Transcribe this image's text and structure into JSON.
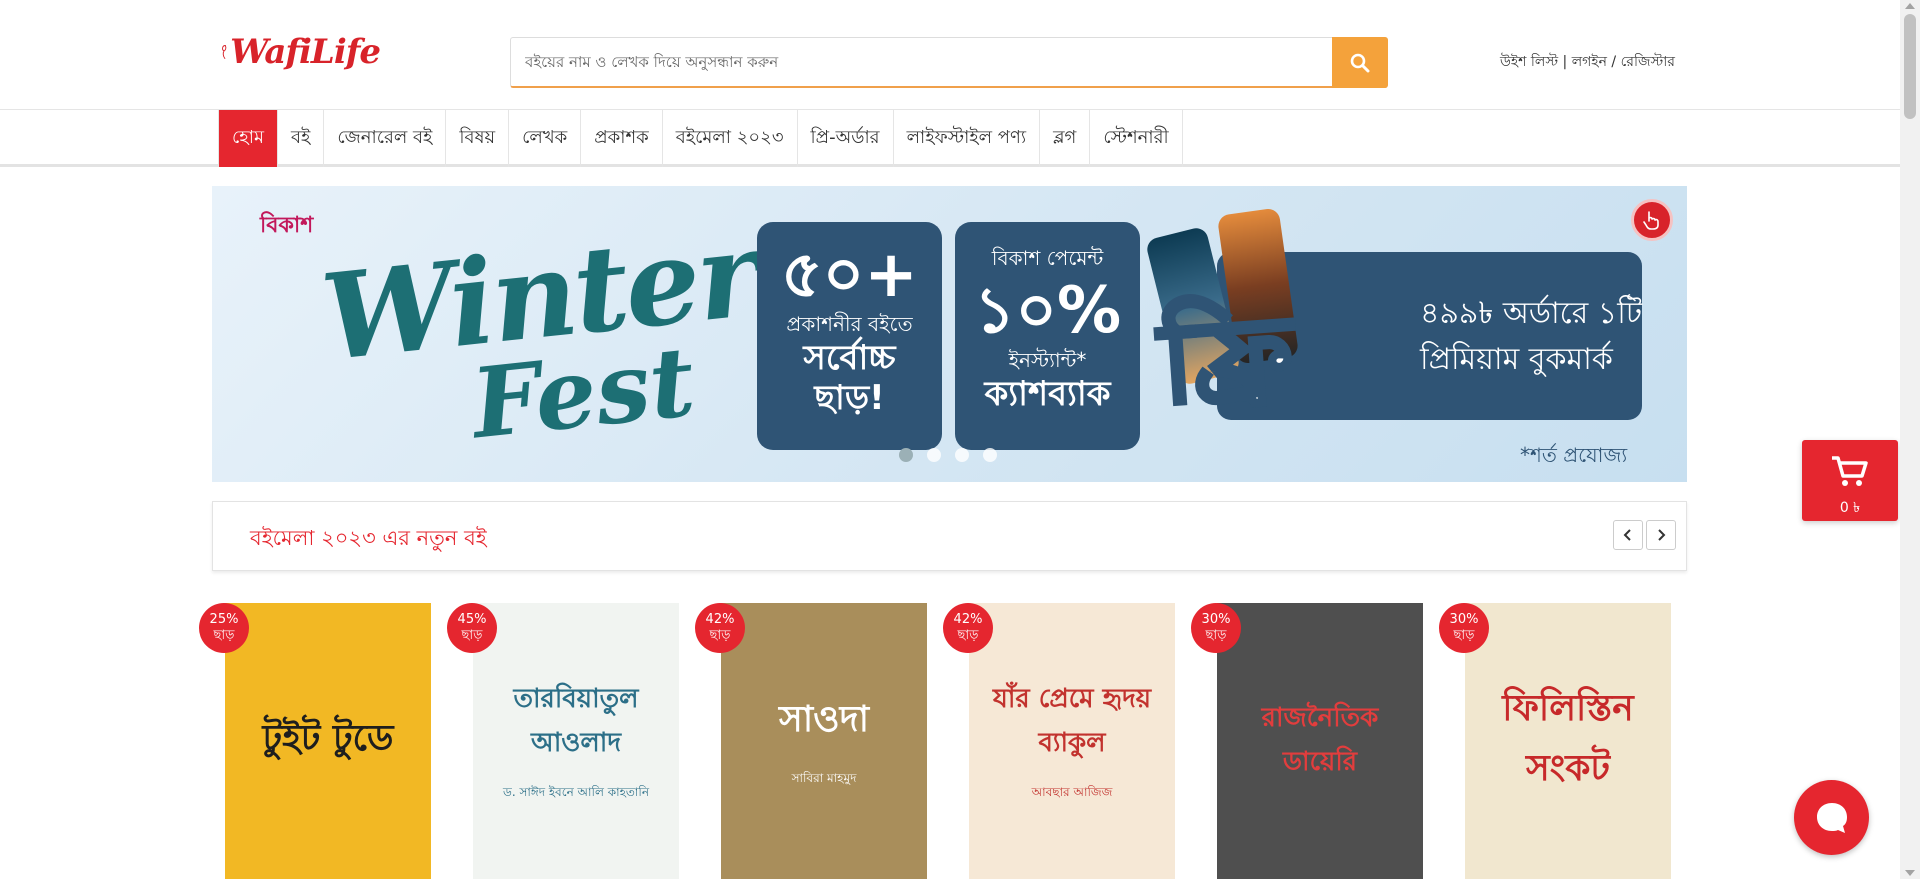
{
  "header": {
    "logo_text": "WafiLife",
    "search_placeholder": "বইয়ের নাম ও লেখক দিয়ে অনুসন্ধান করুন",
    "wishlist": "উইশ লিস্ট",
    "separator": "|",
    "login": "লগইন",
    "slash": "/",
    "register": "রেজিস্টার"
  },
  "nav": {
    "items": [
      "হোম",
      "বই",
      "জেনারেল বই",
      "বিষয়",
      "লেখক",
      "প্রকাশক",
      "বইমেলা ২০২৩",
      "প্রি-অর্ডার",
      "লাইফস্টাইল পণ্য",
      "ব্লগ",
      "স্টেশনারী"
    ],
    "active_index": 0
  },
  "banner": {
    "bkash_logo": "বিকাশ",
    "winter": "Winter",
    "fest": "Fest",
    "card1": {
      "big": "৫০+",
      "line": "প্রকাশনীর বইতে",
      "bold1": "সর্বোচ্চ",
      "bold2": "ছাড়!"
    },
    "card2": {
      "line": "বিকাশ পেমেন্ট",
      "big": "১০%",
      "line2": "ইনস্ট্যান্ট*",
      "bold": "ক্যাশব্যাক"
    },
    "free": "ফ্রি",
    "offer_line1": "৪৯৯৳ অর্ডারে ১টি",
    "offer_line2": "প্রিমিয়াম বুকমার্ক",
    "terms": "*শর্ত প্রযোজ্য",
    "slide_count": 4,
    "active_slide": 0
  },
  "section": {
    "title": "বইমেলা ২০২৩ এর নতুন বই"
  },
  "books": [
    {
      "discount": "25%",
      "off": "ছাড়",
      "title": "টুইট টুডে",
      "author": "",
      "bg": "#f2b824",
      "fg": "#1e1e1e"
    },
    {
      "discount": "45%",
      "off": "ছাড়",
      "title": "তারবিয়াতুল আওলাদ",
      "author": "ড. সাঈদ ইবনে আলি কাহতানি",
      "bg": "#f1f4f1",
      "fg": "#2c6f88"
    },
    {
      "discount": "42%",
      "off": "ছাড়",
      "title": "সাওদা",
      "author": "সাবিরা মাহমুদ",
      "bg": "#a98e5b",
      "fg": "#ffffff"
    },
    {
      "discount": "42%",
      "off": "ছাড়",
      "title": "যাঁর প্রেমে হৃদয় ব্যাকুল",
      "author": "আবছার আজিজ",
      "bg": "#f6e8d6",
      "fg": "#c2322e"
    },
    {
      "discount": "30%",
      "off": "ছাড়",
      "title": "রাজনৈতিক ডায়েরি",
      "author": "",
      "bg": "#4f4f4f",
      "fg": "#e23d3d"
    },
    {
      "discount": "30%",
      "off": "ছাড়",
      "title": "ফিলিস্তিন সংকট",
      "author": "",
      "bg": "#f1e7cf",
      "fg": "#c7292a"
    }
  ],
  "cart": {
    "count": "0 ৳"
  },
  "colors": {
    "brand_red": "#e5262f",
    "search_orange": "#f4a23b",
    "banner_navy": "#2f5475",
    "winter_teal": "#1d6f74"
  }
}
